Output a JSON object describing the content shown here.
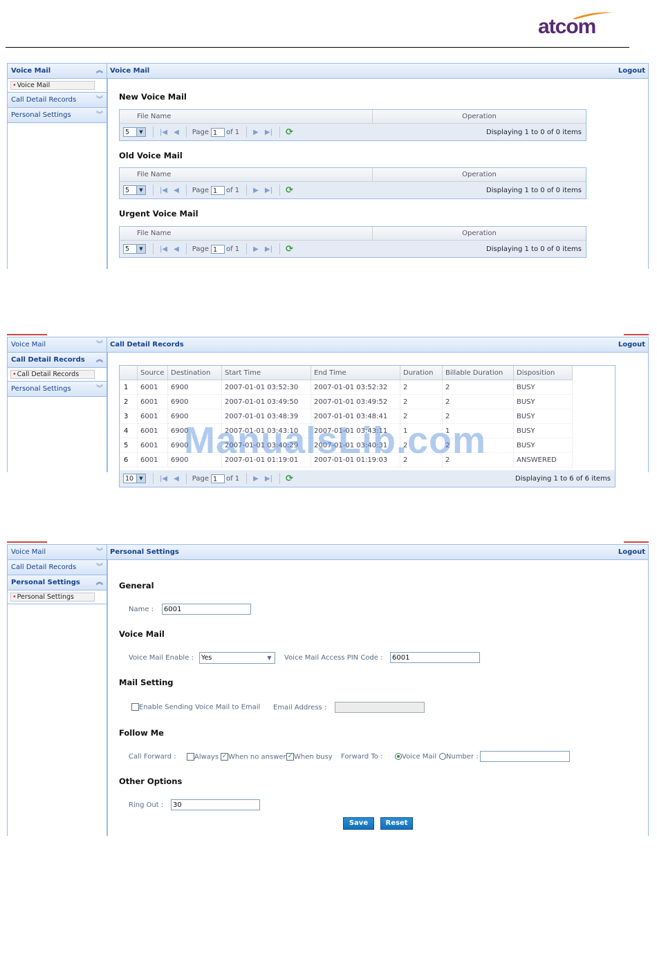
{
  "brand": {
    "logo_text": "atcom"
  },
  "watermark": "ManualsLib.com",
  "sidebar": {
    "voice_mail": "Voice Mail",
    "voice_mail_item": "Voice Mail",
    "cdr": "Call Detail Records",
    "cdr_item": "Call Detail Records",
    "personal": "Personal Settings",
    "personal_item": "Personal Settings"
  },
  "logout": "Logout",
  "panel1": {
    "title": "Voice Mail",
    "sections": [
      {
        "title": "New Voice Mail"
      },
      {
        "title": "Old Voice Mail"
      },
      {
        "title": "Urgent Voice Mail"
      }
    ],
    "col_file": "File Name",
    "col_op": "Operation",
    "page_size": "5",
    "page_label": "Page",
    "page_value": "1",
    "of_label": "of 1",
    "displaying": "Displaying 1 to 0 of 0 items"
  },
  "panel2": {
    "title": "Call Detail Records",
    "columns": [
      "",
      "Source",
      "Destination",
      "Start Time",
      "End Time",
      "Duration",
      "Billable Duration",
      "Disposition"
    ],
    "rows": [
      [
        "1",
        "6001",
        "6900",
        "2007-01-01 03:52:30",
        "2007-01-01 03:52:32",
        "2",
        "2",
        "BUSY"
      ],
      [
        "2",
        "6001",
        "6900",
        "2007-01-01 03:49:50",
        "2007-01-01 03:49:52",
        "2",
        "2",
        "BUSY"
      ],
      [
        "3",
        "6001",
        "6900",
        "2007-01-01 03:48:39",
        "2007-01-01 03:48:41",
        "2",
        "2",
        "BUSY"
      ],
      [
        "4",
        "6001",
        "6900",
        "2007-01-01 03:43:10",
        "2007-01-01 03:43:11",
        "1",
        "1",
        "BUSY"
      ],
      [
        "5",
        "6001",
        "6900",
        "2007-01-01 03:40:29",
        "2007-01-01 03:40:31",
        "2",
        "2",
        "BUSY"
      ],
      [
        "6",
        "6001",
        "6900",
        "2007-01-01 01:19:01",
        "2007-01-01 01:19:03",
        "2",
        "2",
        "ANSWERED"
      ]
    ],
    "page_size": "10",
    "page_label": "Page",
    "page_value": "1",
    "of_label": "of 1",
    "displaying": "Displaying 1 to 6 of 6 items"
  },
  "panel3": {
    "title": "Personal Settings",
    "general": "General",
    "name_label": "Name :",
    "name_value": "6001",
    "voice_mail": "Voice Mail",
    "vm_enable_label": "Voice Mail Enable :",
    "vm_enable_value": "Yes",
    "vm_pin_label": "Voice Mail Access PIN Code :",
    "vm_pin_value": "6001",
    "mail_setting": "Mail Setting",
    "enable_email_label": "Enable Sending Voice Mail to Email",
    "email_label": "Email Address :",
    "email_value": "",
    "follow_me": "Follow Me",
    "call_forward_label": "Call Forward :",
    "always_label": "Always",
    "no_answer_label": "When no answer",
    "busy_label": "When busy",
    "forward_to_label": "Forward To :",
    "fw_voicemail_label": "Voice Mail",
    "fw_number_label": "Number :",
    "fw_number_value": "",
    "other_options": "Other Options",
    "ring_out_label": "Ring Out :",
    "ring_out_value": "30",
    "save": "Save",
    "reset": "Reset"
  }
}
